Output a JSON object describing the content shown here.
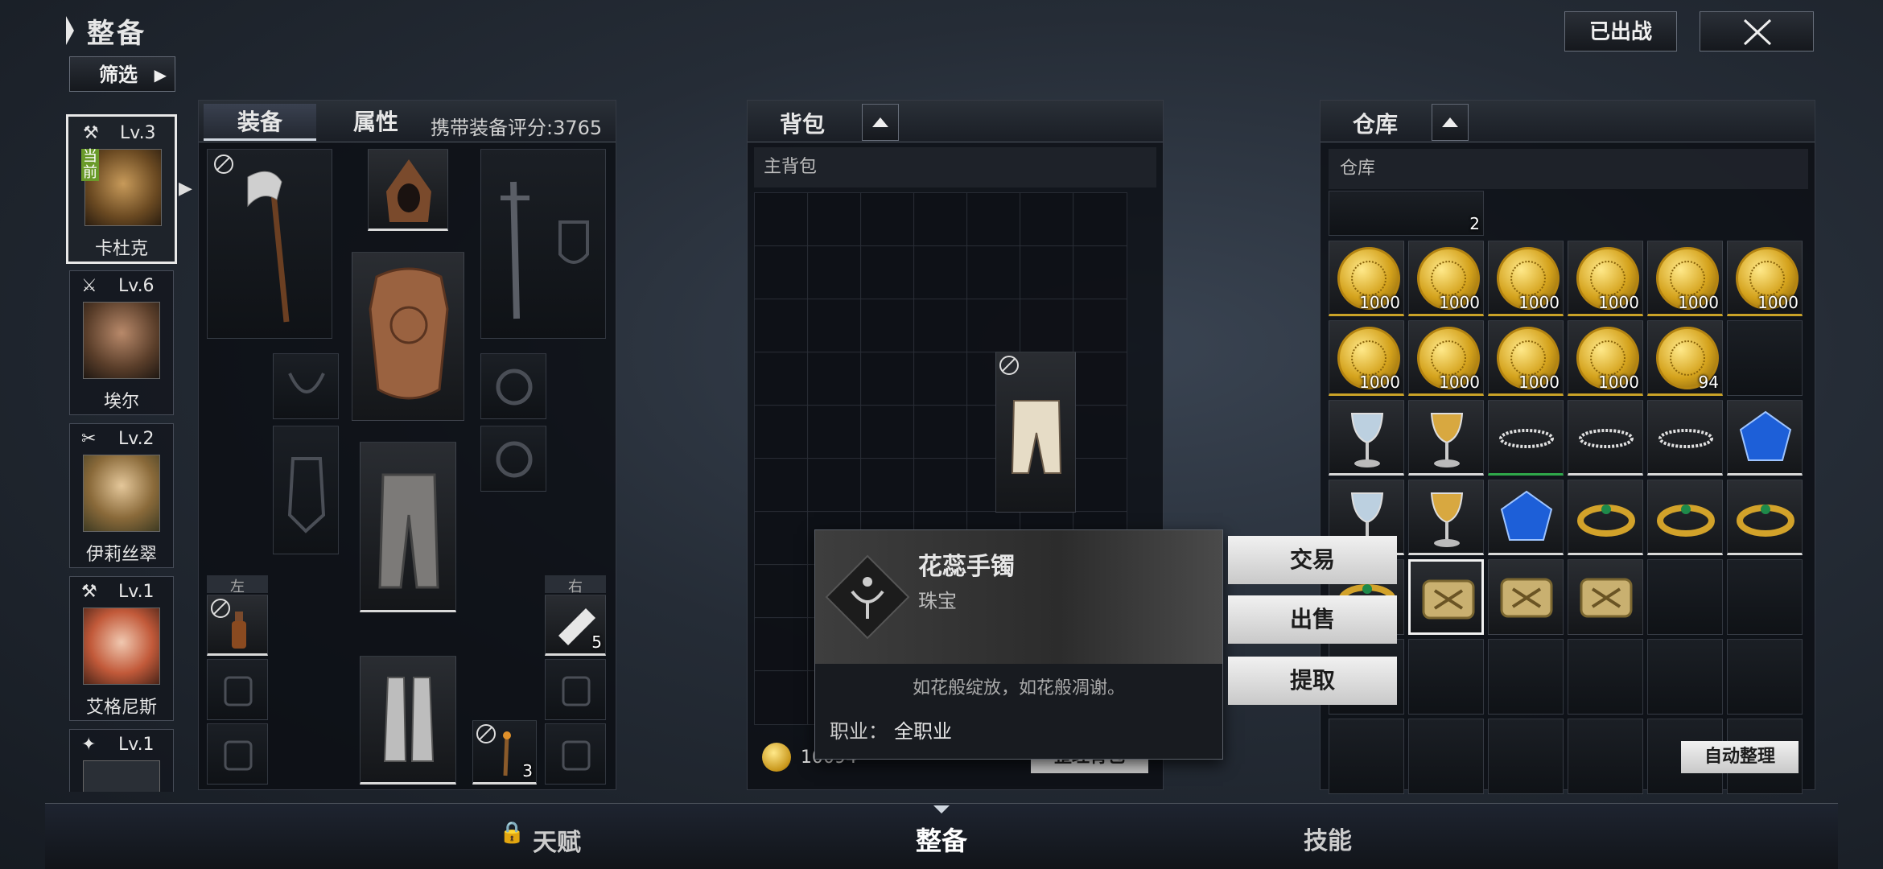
{
  "header": {
    "title": "整备",
    "filter_label": "筛选",
    "deployed_label": "已出战",
    "close_icon": "crossed-swords-close-icon"
  },
  "heroes": [
    {
      "level": "Lv.3",
      "name": "卡杜克",
      "current_badge": "当前",
      "class_icon": "axe-icon"
    },
    {
      "level": "Lv.6",
      "name": "埃尔",
      "class_icon": "sword-icon"
    },
    {
      "level": "Lv.2",
      "name": "伊莉丝翠",
      "class_icon": "crossed-blades-icon"
    },
    {
      "level": "Lv.1",
      "name": "艾格尼斯",
      "class_icon": "hammer-icon"
    },
    {
      "level": "Lv.1",
      "class_icon": "star-icon"
    }
  ],
  "equipment": {
    "tab_equip": "装备",
    "tab_attr": "属性",
    "score_label": "携带装备评分:3765",
    "left_label": "左",
    "right_label": "右",
    "right_qty": "5",
    "torch_qty": "3"
  },
  "backpack": {
    "title": "背包",
    "sub": "主背包",
    "gold": "10094",
    "sort_button": "整理背包"
  },
  "warehouse": {
    "title": "仓库",
    "sub": "仓库",
    "top_qty": "2",
    "auto_sort": "自动整理",
    "row1_qty": [
      "1000",
      "1000",
      "1000",
      "1000",
      "1000",
      "1000"
    ],
    "row2_qty": [
      "1000",
      "1000",
      "1000",
      "1000",
      "94"
    ]
  },
  "tooltip": {
    "name": "花蕊手镯",
    "category": "珠宝",
    "description": "如花般绽放，如花般凋谢。",
    "class_label": "职业：",
    "class_value": "全职业"
  },
  "actions": {
    "trade": "交易",
    "sell": "出售",
    "extract": "提取"
  },
  "bottom_nav": {
    "talent": "天赋",
    "equip": "整备",
    "skills": "技能"
  }
}
